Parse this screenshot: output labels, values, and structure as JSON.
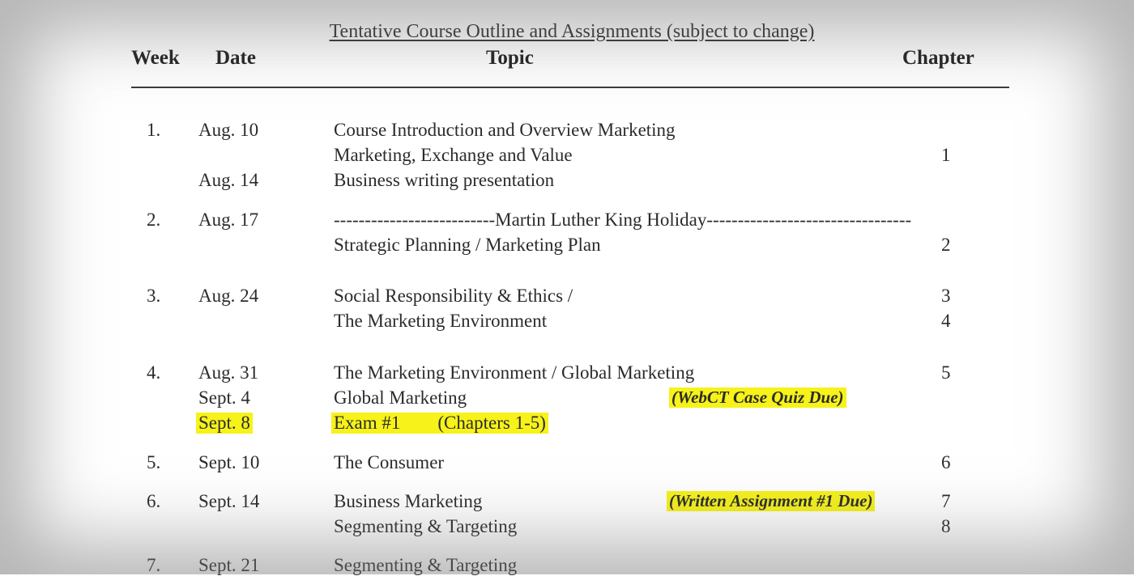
{
  "title": "Tentative Course Outline and Assignments (subject to change)",
  "headers": {
    "week": "Week",
    "date": "Date",
    "topic": "Topic",
    "chapter": "Chapter"
  },
  "rows": {
    "w1_week": "1.",
    "w1_date_a": "Aug. 10",
    "w1_topic_a": "Course Introduction and Overview Marketing",
    "w1_topic_b": "Marketing, Exchange and Value",
    "w1_chapter_b": "1",
    "w1_date_c": "Aug. 14",
    "w1_topic_c": "Business writing presentation",
    "w2_week": "2.",
    "w2_date_a": "Aug. 17",
    "w2_topic_a": "--------------------------Martin Luther King Holiday---------------------------------",
    "w2_topic_b": "Strategic Planning / Marketing Plan",
    "w2_chapter_b": "2",
    "w3_week": "3.",
    "w3_date_a": "Aug. 24",
    "w3_topic_a": "Social Responsibility & Ethics /",
    "w3_chapter_a": "3",
    "w3_topic_b": "The Marketing Environment",
    "w3_chapter_b": "4",
    "w4_week": "4.",
    "w4_date_a": "Aug. 31",
    "w4_topic_a": "The Marketing Environment / Global Marketing",
    "w4_chapter_a": "5",
    "w4_date_b": "Sept. 4",
    "w4_topic_b": "Global Marketing",
    "w4_note_b": "(WebCT Case Quiz Due)",
    "w4_date_c": "Sept. 8",
    "w4_topic_c": "Exam #1        (Chapters 1-5)",
    "w5_week": "5.",
    "w5_date_a": "Sept. 10",
    "w5_topic_a": "The Consumer",
    "w5_chapter_a": "6",
    "w6_week": "6.",
    "w6_date_a": "Sept. 14",
    "w6_topic_a": "Business Marketing",
    "w6_note_a": "(Written Assignment #1 Due)",
    "w6_chapter_a": "7",
    "w6_topic_b": "Segmenting & Targeting",
    "w6_chapter_b": "8",
    "w7_week": "7.",
    "w7_date_a": "Sept. 21",
    "w7_topic_a": "Segmenting & Targeting"
  },
  "colors": {
    "highlight": "#f6f21a",
    "text": "#2b2b2b"
  }
}
